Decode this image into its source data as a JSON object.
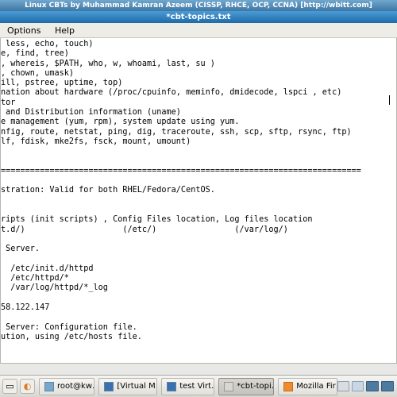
{
  "window": {
    "title_top": "Linux CBTs by Muhammad Kamran Azeem (CISSP, RHCE, OCP, CCNA) [http://wbitt.com]",
    "title_sub": "*cbt-topics.txt"
  },
  "menu": {
    "m1": "Options",
    "m2": "Help"
  },
  "editor_lines": [
    " less, echo, touch)",
    "e, find, tree)",
    ", whereis, $PATH, who, w, whoami, last, su )",
    ", chown, umask)",
    "ill, pstree, uptime, top)",
    "nation about hardware (/proc/cpuinfo, meminfo, dmidecode, lspci , etc)",
    "tor",
    " and Distribution information (uname)",
    "e management (yum, rpm), system update using yum.",
    "nfig, route, netstat, ping, dig, traceroute, ssh, scp, sftp, rsync, ftp)",
    "lf, fdisk, mke2fs, fsck, mount, umount)",
    "",
    "",
    "==========================================================================",
    "",
    "stration: Valid for both RHEL/Fedora/CentOS.",
    "",
    "",
    "ripts (init scripts) , Config Files location, Log files location",
    "t.d/)                    (/etc/)                (/var/log/)",
    "",
    " Server.",
    "",
    "  /etc/init.d/httpd",
    "  /etc/httpd/*",
    "  /var/log/httpd/*_log",
    "",
    "58.122.147",
    "",
    " Server: Configuration file.",
    "ution, using /etc/hosts file.",
    "",
    ""
  ],
  "taskbar": {
    "t1": "root@kw…",
    "t2": "[Virtual M…",
    "t3": "test Virt…",
    "t4": "*cbt-topi…",
    "t5": "Mozilla Fir…"
  }
}
